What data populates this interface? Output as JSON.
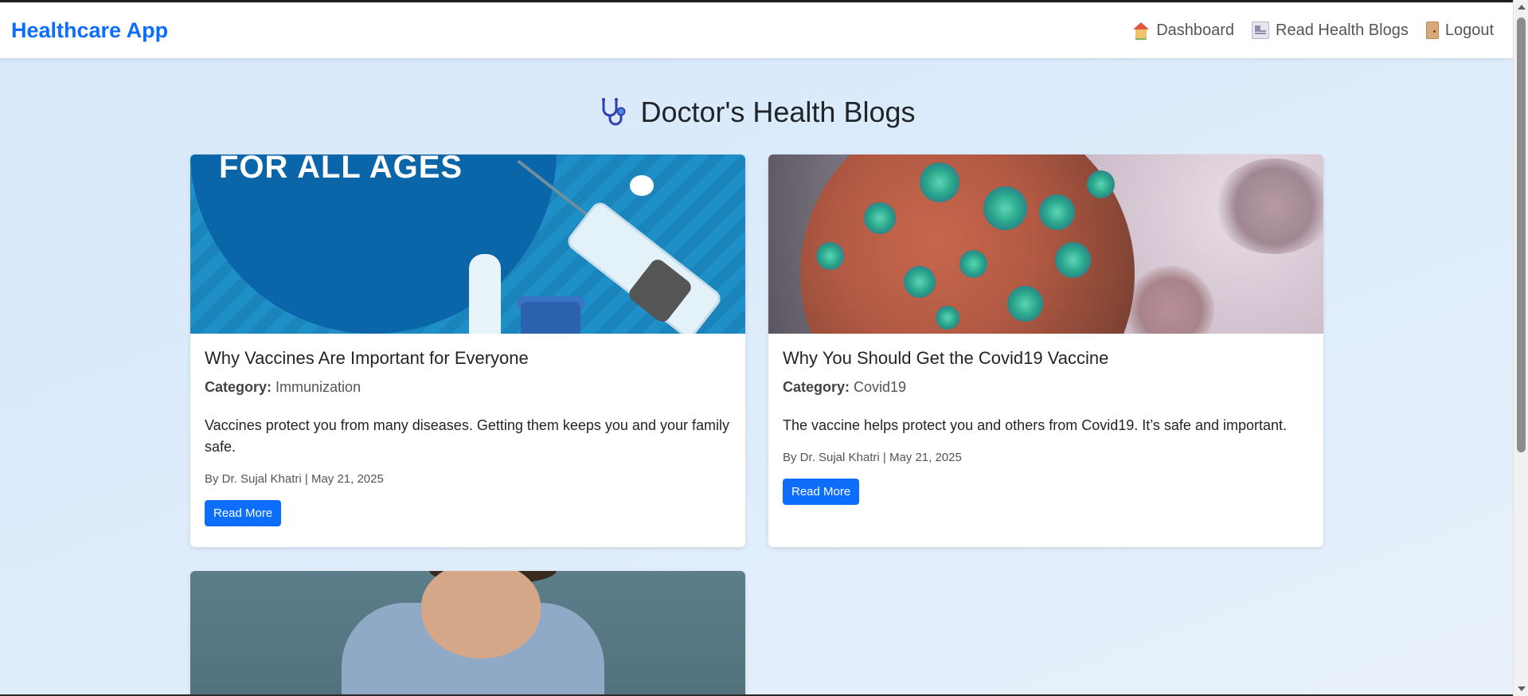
{
  "navbar": {
    "brand": "Healthcare App",
    "links": [
      {
        "label": "Dashboard",
        "icon": "house-icon"
      },
      {
        "label": "Read Health Blogs",
        "icon": "newspaper-icon"
      },
      {
        "label": "Logout",
        "icon": "door-icon"
      }
    ]
  },
  "page": {
    "title": "Doctor's Health Blogs",
    "title_icon": "stethoscope-icon"
  },
  "blogs": [
    {
      "image_headline": "FOR ALL AGES",
      "title": "Why Vaccines Are Important for Everyone",
      "category_label": "Category:",
      "category": "Immunization",
      "excerpt": "Vaccines protect you from many diseases. Getting them keeps you and your family safe.",
      "meta": "By Dr. Sujal Khatri | May 21, 2025",
      "button": "Read More"
    },
    {
      "title": "Why You Should Get the Covid19 Vaccine",
      "category_label": "Category:",
      "category": "Covid19",
      "excerpt": "The vaccine helps protect you and others from Covid19. It’s safe and important.",
      "meta": "By Dr. Sujal Khatri | May 21, 2025",
      "button": "Read More"
    }
  ],
  "colors": {
    "primary": "#0d6efd",
    "background": "#dceafb"
  }
}
